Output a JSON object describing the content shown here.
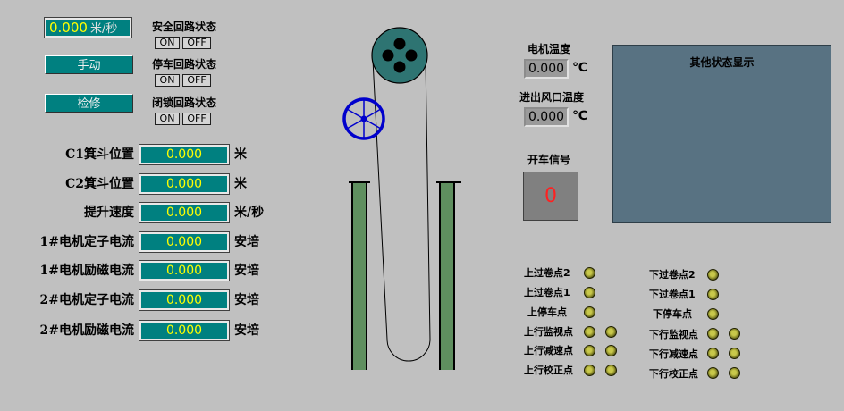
{
  "speed_display": {
    "value": "0.000",
    "unit": "米/秒"
  },
  "mode_buttons": [
    {
      "label": "手动"
    },
    {
      "label": "检修"
    }
  ],
  "circuit_status": [
    {
      "title": "安全回路状态",
      "on": "ON",
      "off": "OFF"
    },
    {
      "title": "停车回路状态",
      "on": "ON",
      "off": "OFF"
    },
    {
      "title": "闭锁回路状态",
      "on": "ON",
      "off": "OFF"
    }
  ],
  "measurements": [
    {
      "label": "C1箕斗位置",
      "value": "0.000",
      "unit": "米"
    },
    {
      "label": "C2箕斗位置",
      "value": "0.000",
      "unit": "米"
    },
    {
      "label": "提升速度",
      "value": "0.000",
      "unit": "米/秒"
    },
    {
      "label": "1#电机定子电流",
      "value": "0.000",
      "unit": "安培"
    },
    {
      "label": "1#电机励磁电流",
      "value": "0.000",
      "unit": "安培"
    },
    {
      "label": "2#电机定子电流",
      "value": "0.000",
      "unit": "安培"
    },
    {
      "label": "2#电机励磁电流",
      "value": "0.000",
      "unit": "安培"
    }
  ],
  "motor_temp": {
    "label": "电机温度",
    "value": "0.000",
    "unit": "℃"
  },
  "vent_temp": {
    "label": "进出风口温度",
    "value": "0.000",
    "unit": "℃"
  },
  "start_signal": {
    "label": "开车信号",
    "value": "0"
  },
  "other_status": {
    "title": "其他状态显示"
  },
  "up_points": [
    {
      "label": "上过卷点2",
      "lamps": 1
    },
    {
      "label": "上过卷点1",
      "lamps": 1
    },
    {
      "label": "上停车点",
      "lamps": 1
    },
    {
      "label": "上行监视点",
      "lamps": 2
    },
    {
      "label": "上行减速点",
      "lamps": 2
    },
    {
      "label": "上行校正点",
      "lamps": 2
    }
  ],
  "down_points": [
    {
      "label": "下过卷点2",
      "lamps": 1
    },
    {
      "label": "下过卷点1",
      "lamps": 1
    },
    {
      "label": "下停车点",
      "lamps": 1
    },
    {
      "label": "下行监视点",
      "lamps": 2
    },
    {
      "label": "下行减速点",
      "lamps": 2
    },
    {
      "label": "下行校正点",
      "lamps": 2
    }
  ],
  "colors": {
    "background": "#c0c0c0",
    "display_bg": "#008080",
    "display_text": "#ffff00",
    "panel_bg": "#587282",
    "signal_text": "#ff2020",
    "wheel_blue": "#0000cc",
    "drum": "#2e7472",
    "shaft_wall": "#5f8f5f"
  }
}
